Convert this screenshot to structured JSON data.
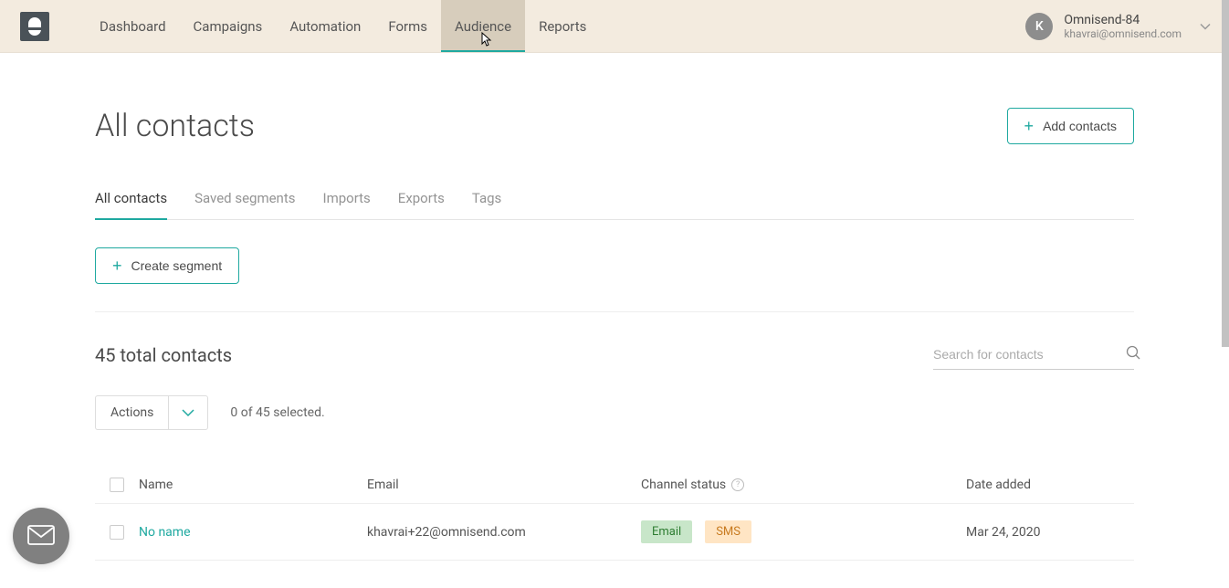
{
  "nav": {
    "items": [
      {
        "label": "Dashboard"
      },
      {
        "label": "Campaigns"
      },
      {
        "label": "Automation"
      },
      {
        "label": "Forms"
      },
      {
        "label": "Audience",
        "active": true
      },
      {
        "label": "Reports"
      }
    ]
  },
  "user": {
    "initial": "K",
    "name": "Omnisend-84",
    "email": "khavrai@omnisend.com"
  },
  "page": {
    "title": "All contacts",
    "add_contacts_label": "Add contacts",
    "create_segment_label": "Create segment"
  },
  "tabs": [
    {
      "label": "All contacts",
      "active": true
    },
    {
      "label": "Saved segments"
    },
    {
      "label": "Imports"
    },
    {
      "label": "Exports"
    },
    {
      "label": "Tags"
    }
  ],
  "stats": {
    "total_text": "45 total contacts",
    "search_placeholder": "Search for contacts"
  },
  "actions": {
    "label": "Actions",
    "selected_text": "0 of 45 selected."
  },
  "table": {
    "headers": {
      "name": "Name",
      "email": "Email",
      "channel": "Channel status",
      "date": "Date added"
    },
    "rows": [
      {
        "name": "No name",
        "email": "khavrai+22@omnisend.com",
        "badges": [
          {
            "label": "Email",
            "type": "email"
          },
          {
            "label": "SMS",
            "type": "sms"
          }
        ],
        "date": "Mar 24, 2020"
      }
    ]
  }
}
